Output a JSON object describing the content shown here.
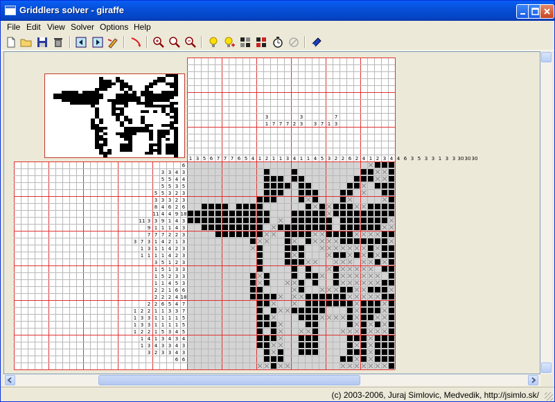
{
  "window": {
    "title": "Griddlers solver - giraffe"
  },
  "menu": [
    "File",
    "Edit",
    "View",
    "Solver",
    "Options",
    "Help"
  ],
  "toolbar": [
    "new-file",
    "open-folder",
    "save-disk",
    "delete-trash",
    "step-back",
    "step-forward",
    "edit-pen",
    "clear-undo",
    "zoom-in",
    "zoom-normal",
    "zoom-out",
    "hint-bulb",
    "hint-plus",
    "solve",
    "solve-all",
    "timer",
    "stop"
  ],
  "puzzle": {
    "name": "giraffe",
    "width": 30,
    "height": 30,
    "row_clues": [
      "6",
      "3 3 4 3",
      "5 5 4 4",
      "5 5 3 5",
      "5 5 3 2 3",
      "3 3 3 2 3",
      "8 4 6 2 6",
      "11 4 4 9 18",
      "11 3 3 9 1 4 3",
      "9 1 1 1 4 3",
      "7 7 7 2 2 3",
      "3 7 3 1 4 2 1 3",
      "1 3 1 1 4 2 3",
      "1 1 1 1 4 2 3",
      "3 5 1 2 3",
      "1 5 1 3 3",
      "1 5 2 3 3",
      "1 1 4 5 3",
      "2 2 1 6 6",
      "2 2 2 4 18",
      "2 2 6 5 4 7",
      "1 2 2 1 1 3 3 7",
      "1 3 3 1 1 1 1 5",
      "1 3 3 1 1 1 1 5",
      "1 2 2 1 5 3 4 5",
      "1 4 1 3 4 3 4",
      "1 3 4 3 3 4 3",
      "3 2 3 3 4 3",
      "6 6"
    ],
    "col_clues_visible": [
      "1",
      "3",
      "5",
      "6",
      "7",
      "7",
      "7",
      "6",
      "5",
      "4",
      "1",
      "2",
      "1",
      "1",
      "3",
      "4",
      "1",
      "1",
      "4",
      "5",
      "3",
      "2",
      "2",
      "6",
      "2",
      "4",
      "1",
      "2",
      "3",
      "4",
      "4",
      "6",
      "3",
      "5",
      "3",
      "3",
      "1",
      "3",
      "3",
      "30",
      "30",
      "30"
    ],
    "col_clue_rows": [
      [
        "",
        "",
        "",
        "",
        "",
        "",
        "",
        "",
        "",
        "",
        "",
        "3",
        "",
        "",
        "",
        "",
        "3",
        "",
        "",
        "",
        "",
        "7",
        "",
        "",
        "",
        "",
        "",
        "",
        "",
        "",
        "",
        "",
        "",
        "",
        "",
        "",
        "",
        "",
        "",
        "",
        "",
        "",
        "",
        "",
        "",
        "",
        "",
        "",
        "",
        "",
        "",
        ""
      ],
      [
        "",
        "",
        "",
        "",
        "",
        "",
        "",
        "",
        "",
        "",
        "",
        "1",
        "7",
        "7",
        "7",
        "2",
        "3",
        "",
        "3",
        "7",
        "1",
        "3",
        "",
        "",
        "",
        "",
        "",
        "",
        "",
        "",
        "",
        "",
        "",
        "",
        "",
        "",
        "",
        "",
        "",
        "",
        "",
        "",
        "",
        "",
        "",
        "",
        "",
        "",
        "",
        "",
        "",
        ""
      ]
    ],
    "grid_rows": [
      "..........................X###",
      "...........#...#.........##XX#",
      "...........###.##.......###XX#",
      "...........####.##.....##X.###",
      "...........###..###...##.X..##",
      "..........###...#X#...#X....X#",
      "..####.####......#X#X###XX####",
      "############...#####X#########",
      "############.X.######.#######X",
      "..#########.X########.######XX",
      "....#######XX.####XX####XXXX##",
      ".........#XX..#X.#XXXX#######X",
      ".........X#...###..XXXXXXX#X##",
      "..........#...#X#...X##X#X#X##",
      "..........#...###XX..XXX.XX#X#",
      "..........#....#.#..X#XXXXX.##",
      ".........#X#...#.##X.#XXXXXX.#",
      ".........#X#..XX#.#..#XXXXXX##",
      ".........##....X#..XXX##XX###X",
      ".........####X.XX######XXXXX##",
      "..........##X..X.#######X###X#",
      "..........#.#XX#####...#X###X#",
      "..........##X...###XXXX#X##XX#",
      "..........###X...##....#X#X#X#",
      "..........#.#X..XX#...XXX#XXX#",
      "..........###X..###....###X###",
      "..........##XX..###....#X#X###",
      "...........#X#..###....###X###",
      "...........###........##X#X###",
      "..........XX#XX.......XXXXXXX#"
    ]
  },
  "status": {
    "text": "(c) 2003-2006, Juraj Simlovic, Medvedik, http://jsimlo.sk/"
  },
  "colors": {
    "grid_line": "#b8b8b8",
    "major_line": "#e03030",
    "cell_bg": "#d4d4d4",
    "filled": "#000000",
    "cross": "#8a8a8a",
    "titlebar": "#0650d8"
  }
}
